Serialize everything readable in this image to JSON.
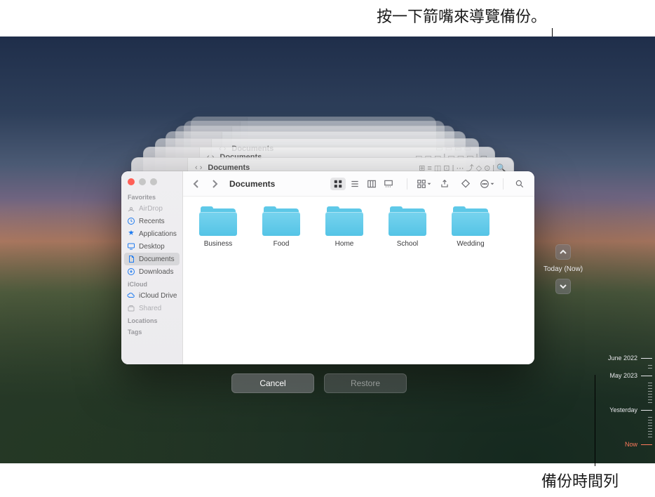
{
  "annotations": {
    "top": "按一下箭嘴來導覽備份。",
    "bottom": "備份時間列"
  },
  "window": {
    "title": "Documents",
    "ghost_title": "Documents"
  },
  "sidebar": {
    "favorites_header": "Favorites",
    "items": [
      {
        "icon": "airdrop",
        "label": "AirDrop",
        "muted": true
      },
      {
        "icon": "recents",
        "label": "Recents"
      },
      {
        "icon": "applications",
        "label": "Applications"
      },
      {
        "icon": "desktop",
        "label": "Desktop"
      },
      {
        "icon": "documents",
        "label": "Documents",
        "selected": true
      },
      {
        "icon": "downloads",
        "label": "Downloads"
      }
    ],
    "icloud_header": "iCloud",
    "icloud_items": [
      {
        "icon": "icloud",
        "label": "iCloud Drive"
      },
      {
        "icon": "shared",
        "label": "Shared",
        "muted": true
      }
    ],
    "locations_header": "Locations",
    "tags_header": "Tags"
  },
  "folders": [
    {
      "label": "Business"
    },
    {
      "label": "Food"
    },
    {
      "label": "Home"
    },
    {
      "label": "School"
    },
    {
      "label": "Wedding"
    }
  ],
  "buttons": {
    "cancel": "Cancel",
    "restore": "Restore"
  },
  "nav": {
    "label": "Today (Now)"
  },
  "timeline": {
    "entries": [
      {
        "label": "June 2022"
      },
      {
        "label": "May 2023"
      },
      {
        "label": "Yesterday"
      },
      {
        "label": "Now",
        "now": true
      }
    ]
  }
}
